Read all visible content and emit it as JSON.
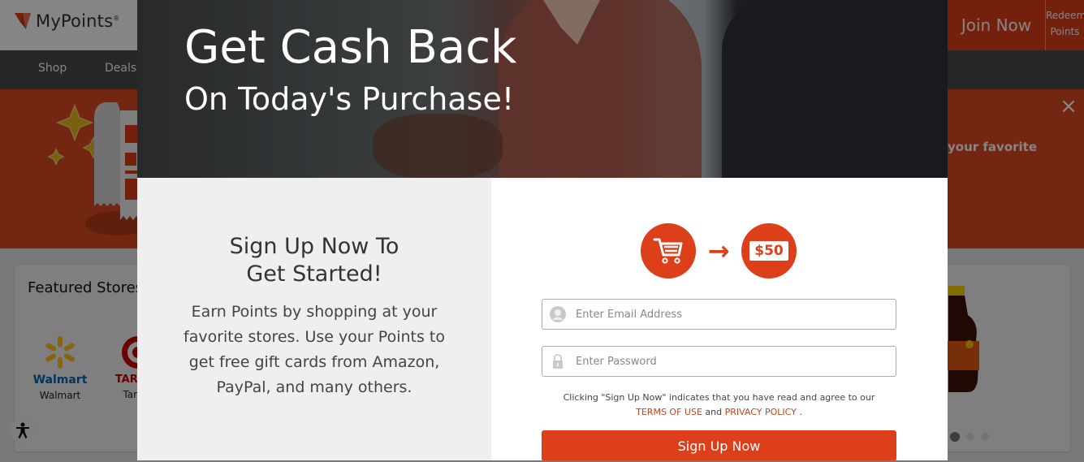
{
  "site": {
    "logo_text": "MyPoints",
    "logo_reg": "®",
    "join_label": "Join Now",
    "redeem_label_line1": "Redeem",
    "redeem_label_line2": "Points",
    "nav": [
      {
        "label": "Shop"
      },
      {
        "label": "Deals"
      }
    ],
    "banner": {
      "text": "your favorite",
      "close_icon": "close-icon"
    },
    "featured": {
      "title": "Featured Stores",
      "stores": [
        {
          "logo_text": "Walmart",
          "name": "Walmart"
        },
        {
          "logo_text": "TARGET",
          "name": "Target"
        }
      ]
    },
    "carousel": {
      "active_index": 0,
      "count": 3
    },
    "accessibility_icon": "accessibility-icon"
  },
  "modal": {
    "hero_title": "Get Cash Back",
    "hero_subtitle": "On Today's Purchase!",
    "left": {
      "heading_line1": "Sign Up Now To",
      "heading_line2": "Get Started!",
      "body": "Earn Points by shopping at your favorite stores. Use your Points to get free gift cards from Amazon, PayPal, and many others."
    },
    "graphic": {
      "cart_icon": "shopping-cart-icon",
      "arrow": "→",
      "cash_amount": "$50"
    },
    "form": {
      "email_placeholder": "Enter Email Address",
      "email_value": "",
      "password_placeholder": "Enter Password",
      "password_value": "",
      "legal_prefix": "Clicking \"Sign Up Now\" indicates that you have read and agree to our",
      "terms_label": "TERMS OF USE",
      "and_label": "and",
      "privacy_label": "PRIVACY POLICY",
      "legal_suffix": ".",
      "submit_label": "Sign Up Now"
    }
  },
  "colors": {
    "brand": "#dd3f1a",
    "nav_bg": "#4a4a4a",
    "link": "#c0461f"
  }
}
